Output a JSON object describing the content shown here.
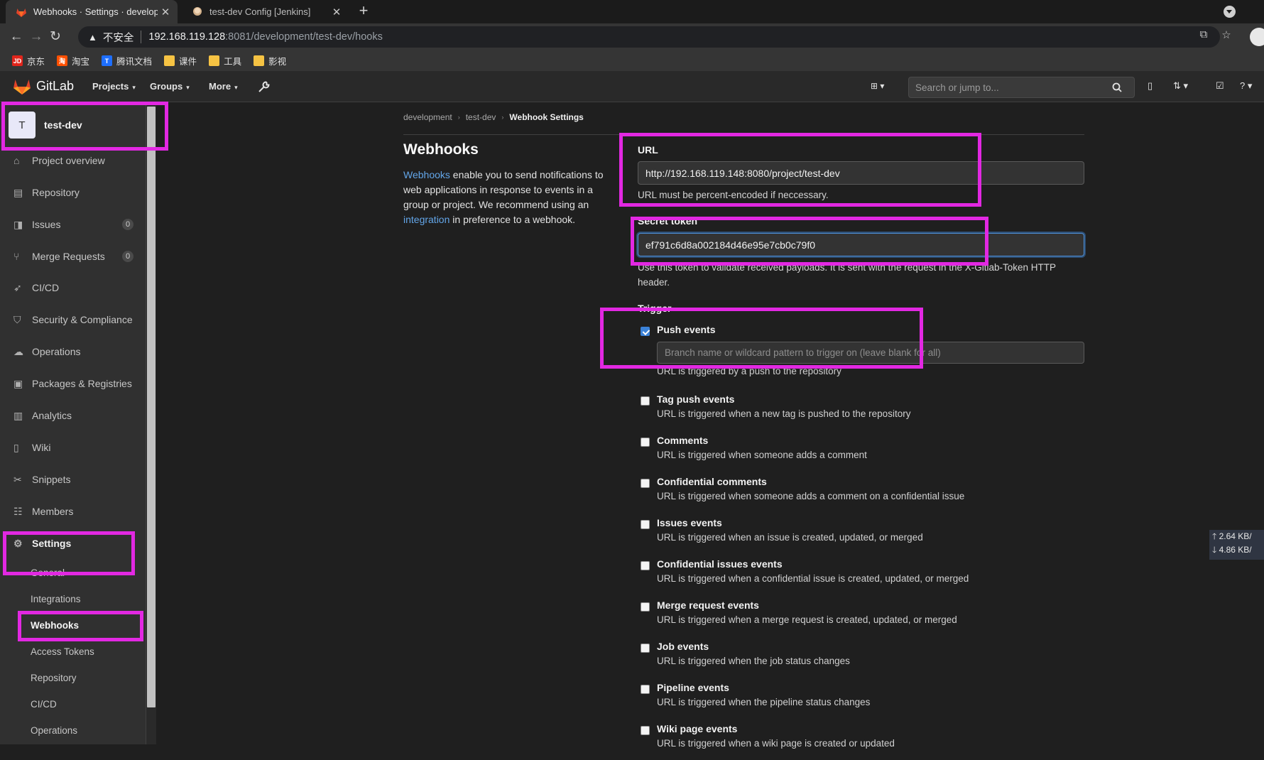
{
  "browser": {
    "tabs": [
      {
        "title": "Webhooks · Settings · development",
        "active": true
      },
      {
        "title": "test-dev Config [Jenkins]",
        "active": false
      }
    ],
    "address": {
      "security": "不安全",
      "host": "192.168.119.128",
      "path": ":8081/development/test-dev/hooks"
    },
    "bookmarks": [
      "京东",
      "淘宝",
      "腾讯文档",
      "课件",
      "工具",
      "影视"
    ]
  },
  "gitlab": {
    "brand": "GitLab",
    "nav": [
      "Projects",
      "Groups",
      "More"
    ],
    "search_placeholder": "Search or jump to..."
  },
  "sidebar": {
    "project_initial": "T",
    "project_name": "test-dev",
    "items": [
      {
        "label": "Project overview",
        "icon": "home-icon"
      },
      {
        "label": "Repository",
        "icon": "repository-icon"
      },
      {
        "label": "Issues",
        "icon": "issues-icon",
        "count": "0"
      },
      {
        "label": "Merge Requests",
        "icon": "merge-request-icon",
        "count": "0"
      },
      {
        "label": "CI/CD",
        "icon": "rocket-icon"
      },
      {
        "label": "Security & Compliance",
        "icon": "shield-icon"
      },
      {
        "label": "Operations",
        "icon": "cloud-gear-icon"
      },
      {
        "label": "Packages & Registries",
        "icon": "package-icon"
      },
      {
        "label": "Analytics",
        "icon": "chart-icon"
      },
      {
        "label": "Wiki",
        "icon": "book-icon"
      },
      {
        "label": "Snippets",
        "icon": "scissors-icon"
      },
      {
        "label": "Members",
        "icon": "users-icon"
      },
      {
        "label": "Settings",
        "icon": "gear-icon"
      }
    ],
    "sub_items": [
      "General",
      "Integrations",
      "Webhooks",
      "Access Tokens",
      "Repository",
      "CI/CD",
      "Operations"
    ]
  },
  "breadcrumb": [
    "development",
    "test-dev",
    "Webhook Settings"
  ],
  "webhooks": {
    "title": "Webhooks",
    "desc_link1": "Webhooks",
    "desc_mid": " enable you to send notifications to web applications in response to events in a group or project. We recommend using an ",
    "desc_link2": "integration",
    "desc_end": " in preference to a webhook.",
    "url_label": "URL",
    "url_value": "http://192.168.119.148:8080/project/test-dev",
    "url_help": "URL must be percent-encoded if neccessary.",
    "token_label": "Secret token",
    "token_value": "ef791c6d8a002184d46e95e7cb0c79f0",
    "token_help": "Use this token to validate received payloads. It is sent with the request in the X-Gitlab-Token HTTP header.",
    "trigger_label": "Trigger",
    "branch_placeholder": "Branch name or wildcard pattern to trigger on (leave blank for all)",
    "triggers": [
      {
        "label": "Push events",
        "desc": "URL is triggered by a push to the repository",
        "checked": true
      },
      {
        "label": "Tag push events",
        "desc": "URL is triggered when a new tag is pushed to the repository",
        "checked": false
      },
      {
        "label": "Comments",
        "desc": "URL is triggered when someone adds a comment",
        "checked": false
      },
      {
        "label": "Confidential comments",
        "desc": "URL is triggered when someone adds a comment on a confidential issue",
        "checked": false
      },
      {
        "label": "Issues events",
        "desc": "URL is triggered when an issue is created, updated, or merged",
        "checked": false
      },
      {
        "label": "Confidential issues events",
        "desc": "URL is triggered when a confidential issue is created, updated, or merged",
        "checked": false
      },
      {
        "label": "Merge request events",
        "desc": "URL is triggered when a merge request is created, updated, or merged",
        "checked": false
      },
      {
        "label": "Job events",
        "desc": "URL is triggered when the job status changes",
        "checked": false
      },
      {
        "label": "Pipeline events",
        "desc": "URL is triggered when the pipeline status changes",
        "checked": false
      },
      {
        "label": "Wiki page events",
        "desc": "URL is triggered when a wiki page is created or updated",
        "checked": false
      }
    ]
  },
  "netmon": {
    "up": "2.64 KB/",
    "down": "4.86 KB/"
  },
  "colors": {
    "annotation": "#e228e2",
    "link": "#63a6e9",
    "checkbox": "#3b82d8"
  }
}
